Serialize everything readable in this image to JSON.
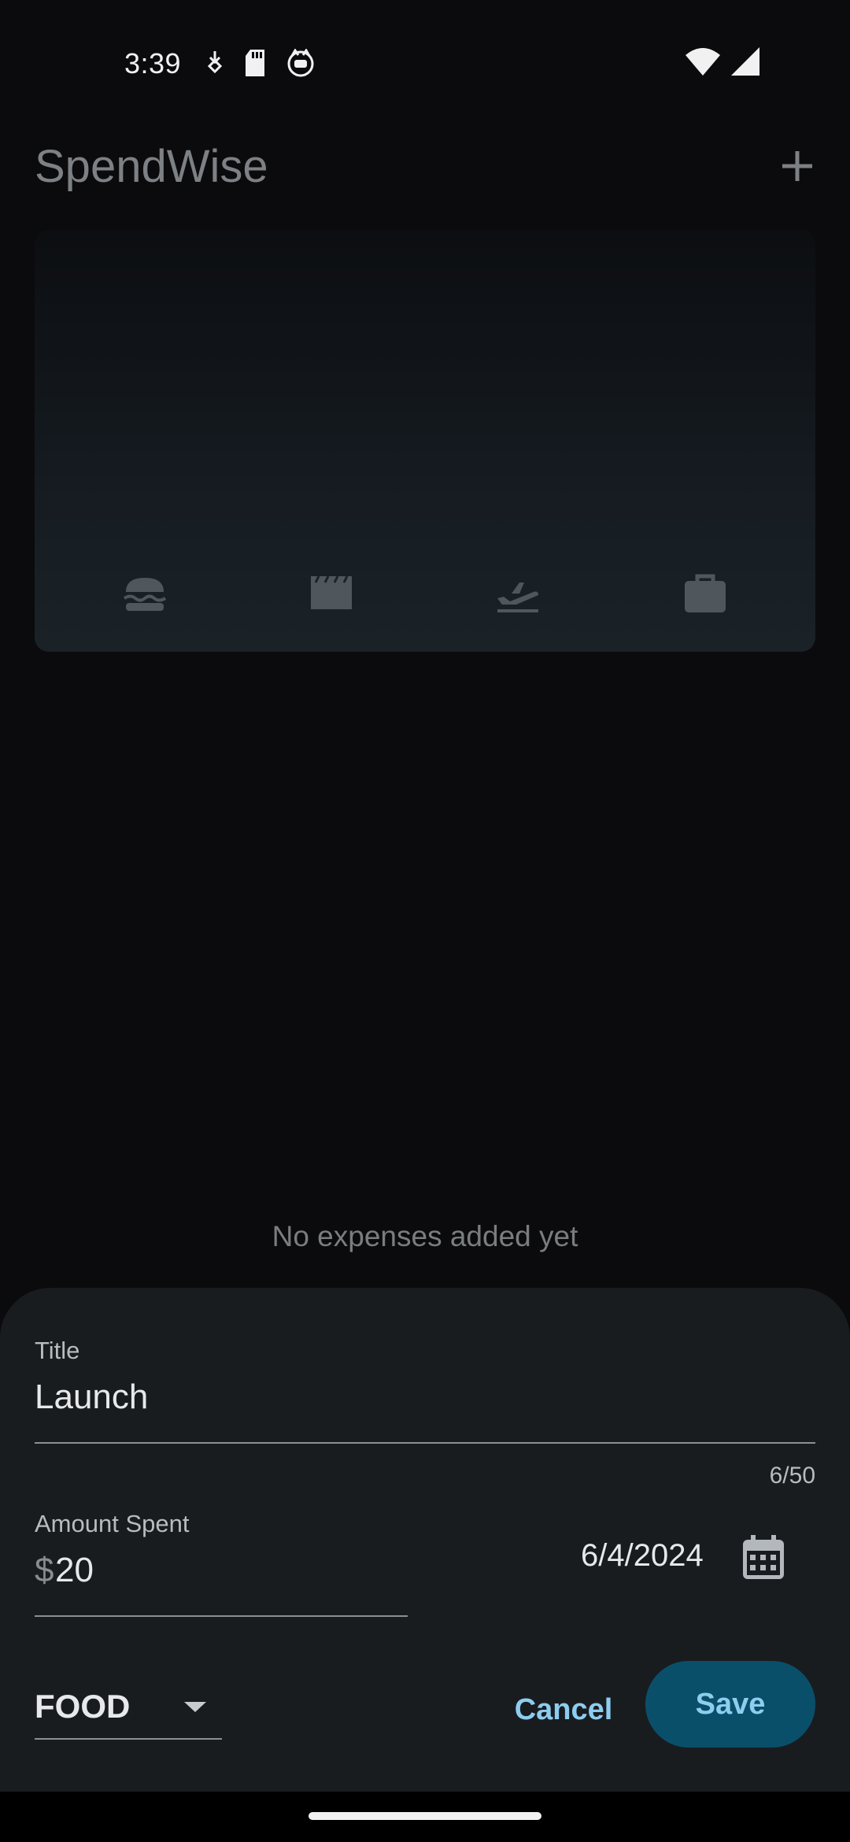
{
  "status_bar": {
    "time": "3:39",
    "left_icons": [
      "download-icon",
      "sd-card-icon",
      "cat-face-icon"
    ],
    "right_icons": [
      "wifi-icon",
      "cell-signal-icon"
    ]
  },
  "app_bar": {
    "title": "SpendWise",
    "add_icon": "plus-icon"
  },
  "chart": {
    "categories": [
      "food",
      "leisure",
      "travel",
      "work"
    ],
    "icons": [
      "burger-icon",
      "clapperboard-icon",
      "flight-takeoff-icon",
      "briefcase-icon"
    ]
  },
  "empty_state": "No expenses added yet",
  "form": {
    "title_label": "Title",
    "title_value": "Launch",
    "char_counter": "6/50",
    "amount_label": "Amount Spent",
    "amount_prefix": "$",
    "amount_value": "20",
    "date_value": "6/4/2024",
    "calendar_icon": "calendar-icon",
    "category_value": "FOOD",
    "cancel_label": "Cancel",
    "save_label": "Save"
  },
  "colors": {
    "background": "#0b0b0d",
    "sheet": "#191c1f",
    "accent": "#8ccdf0",
    "save_button": "#0a4f6a"
  }
}
